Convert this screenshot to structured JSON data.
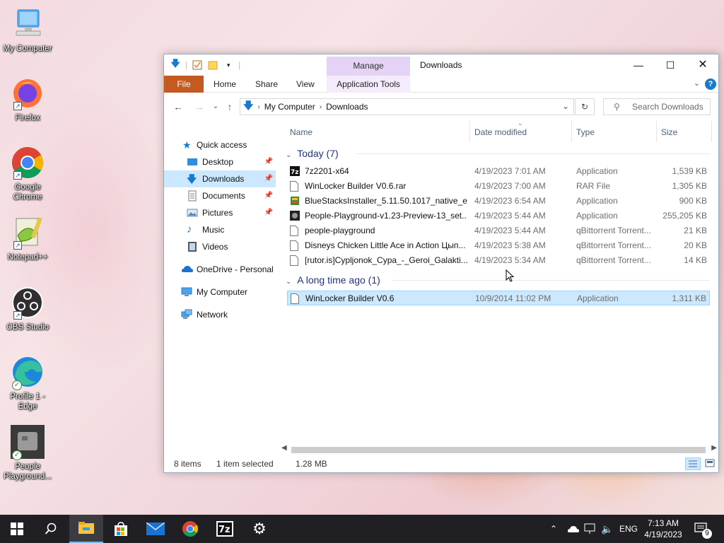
{
  "desktop": {
    "icons": [
      {
        "label": "My Computer",
        "icon": "computer-icon"
      },
      {
        "label": "Firefox",
        "icon": "firefox-icon"
      },
      {
        "label": "Google Chrome",
        "icon": "chrome-icon"
      },
      {
        "label": "Notepad++",
        "icon": "notepadpp-icon"
      },
      {
        "label": "OBS Studio",
        "icon": "obs-icon"
      },
      {
        "label": "Profile 1 - Edge",
        "icon": "edge-icon"
      },
      {
        "label": "People Playground...",
        "icon": "people-playground-icon"
      }
    ]
  },
  "window": {
    "title": "Downloads",
    "context_tab": "Manage",
    "ribbon_tabs": [
      "File",
      "Home",
      "Share",
      "View",
      "Application Tools"
    ],
    "address": [
      "My Computer",
      "Downloads"
    ],
    "search_placeholder": "Search Downloads",
    "nav": [
      {
        "label": "Quick access",
        "icon": "star-icon",
        "pinned": false
      },
      {
        "label": "Desktop",
        "icon": "desktop-folder-icon",
        "pinned": true
      },
      {
        "label": "Downloads",
        "icon": "downloads-folder-icon",
        "pinned": true,
        "selected": true
      },
      {
        "label": "Documents",
        "icon": "documents-folder-icon",
        "pinned": true
      },
      {
        "label": "Pictures",
        "icon": "pictures-folder-icon",
        "pinned": true
      },
      {
        "label": "Music",
        "icon": "music-folder-icon",
        "pinned": false
      },
      {
        "label": "Videos",
        "icon": "videos-folder-icon",
        "pinned": false
      },
      {
        "label": "OneDrive - Personal",
        "icon": "onedrive-icon",
        "pinned": false
      },
      {
        "label": "My Computer",
        "icon": "computer-icon",
        "pinned": false
      },
      {
        "label": "Network",
        "icon": "network-icon",
        "pinned": false
      }
    ],
    "columns": {
      "name": "Name",
      "date": "Date modified",
      "type": "Type",
      "size": "Size"
    },
    "groups": [
      {
        "title": "Today (7)",
        "files": [
          {
            "name": "7z2201-x64",
            "date": "4/19/2023 7:01 AM",
            "type": "Application",
            "size": "1,539 KB",
            "icon": "7zip-icon"
          },
          {
            "name": "WinLocker Builder V0.6.rar",
            "date": "4/19/2023 7:00 AM",
            "type": "RAR File",
            "size": "1,305 KB",
            "icon": "file-icon"
          },
          {
            "name": "BlueStacksInstaller_5.11.50.1017_native_e...",
            "date": "4/19/2023 6:54 AM",
            "type": "Application",
            "size": "900 KB",
            "icon": "bluestacks-icon"
          },
          {
            "name": "People-Playground-v1.23-Preview-13_set...",
            "date": "4/19/2023 5:44 AM",
            "type": "Application",
            "size": "255,205 KB",
            "icon": "installer-icon"
          },
          {
            "name": "people-playground",
            "date": "4/19/2023 5:44 AM",
            "type": "qBittorrent Torrent...",
            "size": "21 KB",
            "icon": "file-icon"
          },
          {
            "name": "Disneys Chicken Little Ace in Action Цып...",
            "date": "4/19/2023 5:38 AM",
            "type": "qBittorrent Torrent...",
            "size": "20 KB",
            "icon": "file-icon"
          },
          {
            "name": "[rutor.is]Cypljonok_Cypa_-_Geroi_Galakti...",
            "date": "4/19/2023 5:34 AM",
            "type": "qBittorrent Torrent...",
            "size": "14 KB",
            "icon": "file-icon"
          }
        ]
      },
      {
        "title": "A long time ago (1)",
        "files": [
          {
            "name": "WinLocker Builder V0.6",
            "date": "10/9/2014 11:02 PM",
            "type": "Application",
            "size": "1,311 KB",
            "icon": "file-icon",
            "selected": true
          }
        ]
      }
    ],
    "status": {
      "count": "8 items",
      "selected": "1 item selected",
      "size": "1.28 MB"
    }
  },
  "taskbar": {
    "apps": [
      "start-icon",
      "search-icon",
      "file-explorer-icon",
      "store-icon",
      "mail-icon",
      "chrome-icon",
      "7zip-icon",
      "settings-icon"
    ],
    "language": "ENG",
    "time": "7:13 AM",
    "date": "4/19/2023",
    "notifications": "9"
  },
  "colors": {
    "accent": "#0078d7",
    "file_tab": "#c45a1f",
    "context_tab": "#e5d3f6",
    "selection": "#cce8ff",
    "group_title": "#1e3287"
  }
}
